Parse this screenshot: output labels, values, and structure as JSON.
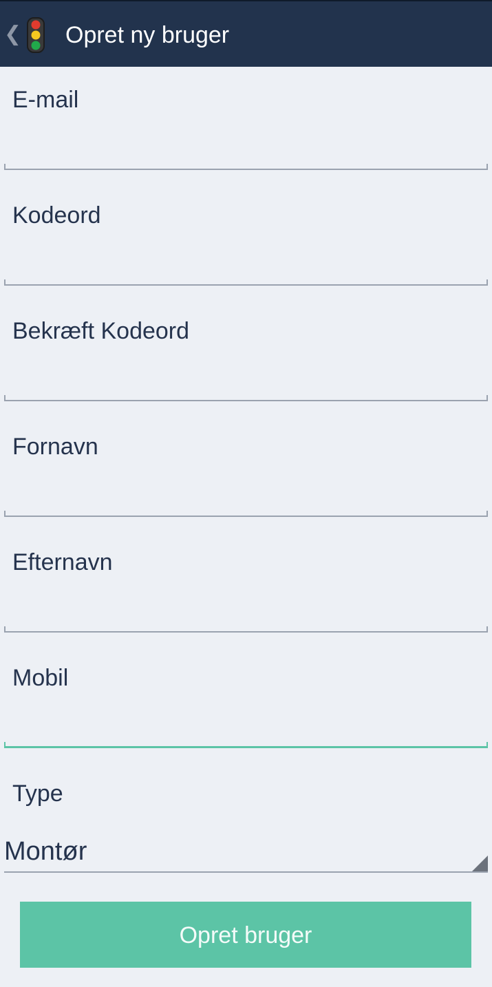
{
  "header": {
    "back_glyph": "❮",
    "logo_icon": "traffic-light-icon",
    "title": "Opret ny bruger"
  },
  "form": {
    "fields": [
      {
        "label": "E-mail",
        "value": ""
      },
      {
        "label": "Kodeord",
        "value": ""
      },
      {
        "label": "Bekræft Kodeord",
        "value": ""
      },
      {
        "label": "Fornavn",
        "value": ""
      },
      {
        "label": "Efternavn",
        "value": ""
      },
      {
        "label": "Mobil",
        "value": "",
        "focused": true
      }
    ],
    "type": {
      "label": "Type",
      "selected": "Montør"
    },
    "submit_label": "Opret bruger"
  },
  "colors": {
    "header_bg": "#22334d",
    "page_bg": "#edf0f5",
    "accent": "#5cc4a6",
    "text": "#25334d"
  }
}
